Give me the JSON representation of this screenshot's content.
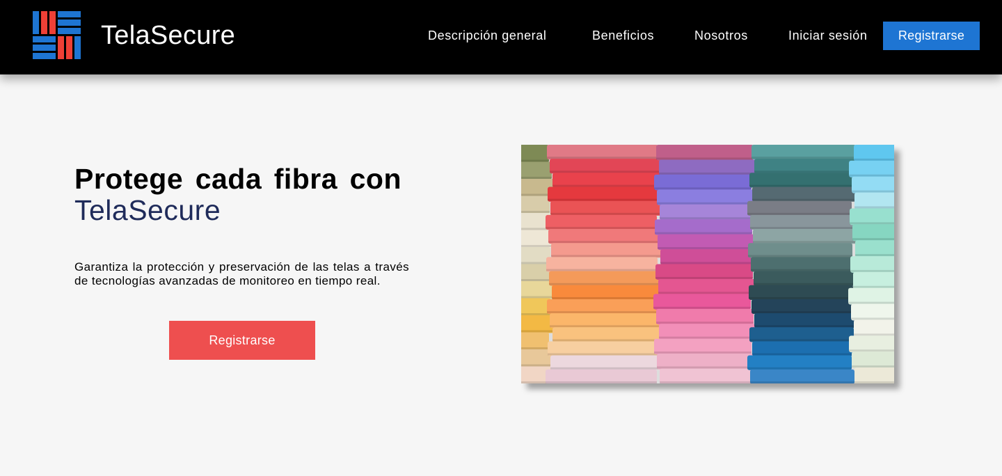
{
  "header": {
    "brand": "TelaSecure",
    "logo_colors": {
      "blue": "#1e75d3",
      "red": "#ee4036"
    },
    "nav": {
      "overview": "Descripción general",
      "benefits": "Beneficios",
      "about": "Nosotros",
      "login": "Iniciar sesión",
      "signup": "Registrarse"
    }
  },
  "hero": {
    "title_line1": "Protege cada fibra con",
    "title_accent": "TelaSecure",
    "description": "Garantiza la protección y preservación de las telas a través de tecnologías avanzadas de monitoreo en tiempo real.",
    "cta": "Registrarse",
    "image": {
      "subject": "stacked-colorful-fabric-rolls"
    }
  },
  "colors": {
    "header_bg": "#000000",
    "page_bg": "#f6f6f6",
    "primary_blue": "#1e75d3",
    "cta_red": "#ee4f4f",
    "accent_navy": "#1f2b5a"
  }
}
